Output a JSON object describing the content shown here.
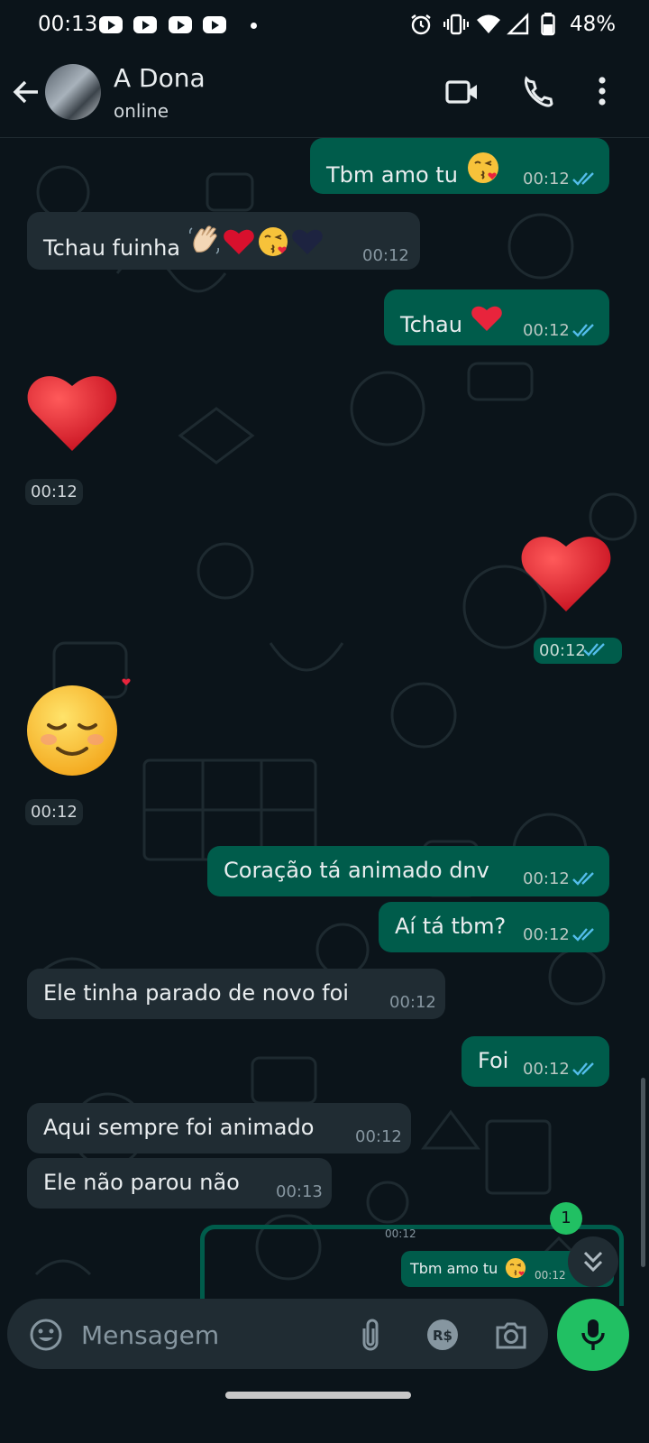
{
  "status_bar": {
    "time": "00:13",
    "battery": "48%",
    "notification_icons": [
      "youtube-icon",
      "youtube-icon",
      "youtube-icon",
      "youtube-icon",
      "dot-icon"
    ],
    "system_icons": [
      "alarm-icon",
      "vibrate-icon",
      "wifi-icon",
      "signal-icon",
      "battery-icon"
    ]
  },
  "header": {
    "contact_name": "A Dona",
    "contact_status": "online"
  },
  "messages": [
    {
      "dir": "out",
      "text": "Tbm amo tu",
      "emojis": [
        "kiss-face"
      ],
      "time": "00:12",
      "read": true
    },
    {
      "dir": "in",
      "text": "Tchau fuinha",
      "emojis": [
        "waving-hand",
        "heart-red",
        "kiss-face",
        "heart-navy"
      ],
      "time": "00:12"
    },
    {
      "dir": "out",
      "text": "Tchau",
      "emojis": [
        "heart-red"
      ],
      "time": "00:12",
      "read": true
    },
    {
      "dir": "in",
      "big_emoji": "heart-red",
      "time": "00:12"
    },
    {
      "dir": "out",
      "big_emoji": "heart-red",
      "time": "00:12",
      "read": true
    },
    {
      "dir": "in",
      "big_emoji": "smiling-face",
      "time": "00:12"
    },
    {
      "dir": "out",
      "text": "Coração tá animado dnv",
      "time": "00:12",
      "read": true
    },
    {
      "dir": "out",
      "text": "Aí tá tbm?",
      "time": "00:12",
      "read": true
    },
    {
      "dir": "in",
      "text": "Ele tinha parado de novo foi",
      "time": "00:12"
    },
    {
      "dir": "out",
      "text": "Foi",
      "time": "00:12",
      "read": true
    },
    {
      "dir": "in",
      "text": "Aqui sempre foi animado",
      "time": "00:12"
    },
    {
      "dir": "in",
      "text": "Ele não parou não",
      "time": "00:13"
    }
  ],
  "reply_preview": {
    "text": "Tbm amo tu",
    "time": "00:12",
    "top_time": "00:12"
  },
  "unread_count": "1",
  "composer": {
    "placeholder": "Mensagem",
    "value": ""
  },
  "colors": {
    "outgoing_bubble": "#005c4b",
    "incoming_bubble": "#202c33",
    "accent_green": "#21c063",
    "read_ticks": "#53bdeb",
    "background": "#0b141a"
  }
}
